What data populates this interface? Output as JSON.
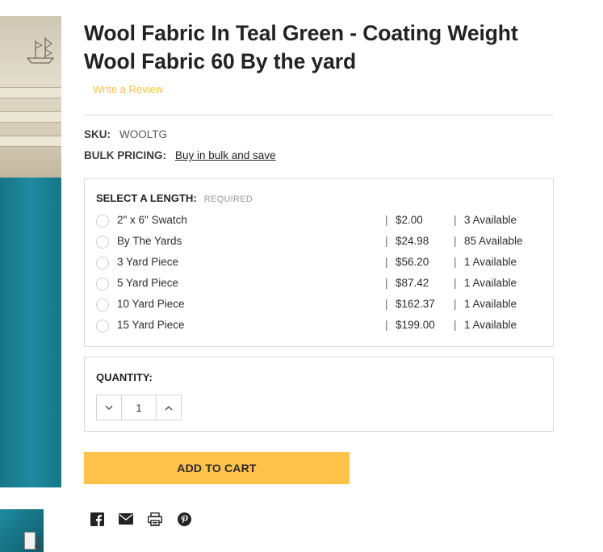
{
  "product": {
    "title": "Wool Fabric In Teal Green - Coating Weight Wool Fabric 60 By the yard",
    "review_link": "Write a Review",
    "sku_label": "SKU:",
    "sku_value": "WOOLTG",
    "bulk_label": "BULK PRICING:",
    "bulk_link": "Buy in bulk and save"
  },
  "length_select": {
    "heading": "SELECT A LENGTH:",
    "required": "REQUIRED",
    "options": [
      {
        "name": "2\" x 6\" Swatch",
        "price": "$2.00",
        "available": "3 Available"
      },
      {
        "name": "By The Yards",
        "price": "$24.98",
        "available": "85 Available"
      },
      {
        "name": "3 Yard Piece",
        "price": "$56.20",
        "available": "1 Available"
      },
      {
        "name": "5 Yard Piece",
        "price": "$87.42",
        "available": "1 Available"
      },
      {
        "name": "10 Yard Piece",
        "price": "$162.37",
        "available": "1 Available"
      },
      {
        "name": "15 Yard Piece",
        "price": "$199.00",
        "available": "1 Available"
      }
    ],
    "separator": "|"
  },
  "quantity": {
    "heading": "QUANTITY:",
    "value": "1"
  },
  "cart": {
    "label": "ADD TO CART"
  },
  "share": {
    "icons": [
      "facebook-icon",
      "email-icon",
      "print-icon",
      "pinterest-icon"
    ]
  },
  "colors": {
    "accent": "#ffc24b",
    "review_link": "#f7c04a",
    "fabric_teal": "#1c7c8f"
  }
}
